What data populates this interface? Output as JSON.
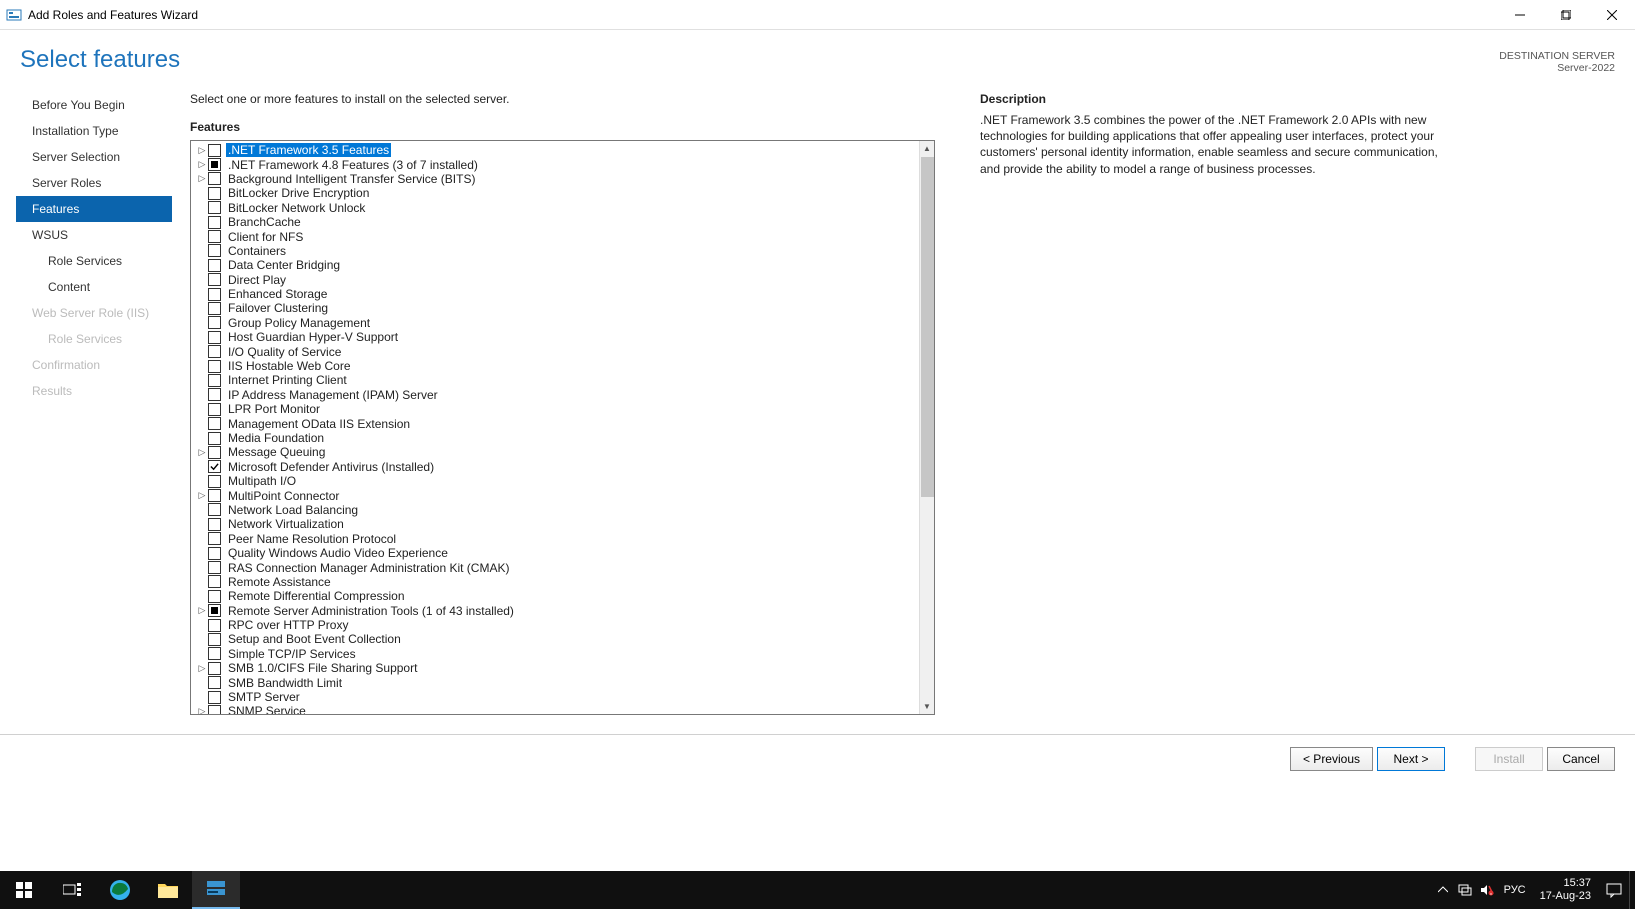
{
  "window": {
    "title": "Add Roles and Features Wizard"
  },
  "header": {
    "page_title": "Select features",
    "dest_label": "DESTINATION SERVER",
    "dest_value": "Server-2022"
  },
  "sidebar": {
    "items": [
      {
        "label": "Before You Begin",
        "state": "normal"
      },
      {
        "label": "Installation Type",
        "state": "normal"
      },
      {
        "label": "Server Selection",
        "state": "normal"
      },
      {
        "label": "Server Roles",
        "state": "normal"
      },
      {
        "label": "Features",
        "state": "active"
      },
      {
        "label": "WSUS",
        "state": "normal"
      },
      {
        "label": "Role Services",
        "state": "normal",
        "indent": 1
      },
      {
        "label": "Content",
        "state": "normal",
        "indent": 1
      },
      {
        "label": "Web Server Role (IIS)",
        "state": "disabled"
      },
      {
        "label": "Role Services",
        "state": "disabled",
        "indent": 1
      },
      {
        "label": "Confirmation",
        "state": "disabled"
      },
      {
        "label": "Results",
        "state": "disabled"
      }
    ]
  },
  "main": {
    "instruction": "Select one or more features to install on the selected server.",
    "features_heading": "Features",
    "description_heading": "Description",
    "description_text": ".NET Framework 3.5 combines the power of the .NET Framework 2.0 APIs with new technologies for building applications that offer appealing user interfaces, protect your customers' personal identity information, enable seamless and secure communication, and provide the ability to model a range of business processes.",
    "features": [
      {
        "label": ".NET Framework 3.5 Features",
        "expandable": true,
        "check": "unchecked",
        "selected": true
      },
      {
        "label": ".NET Framework 4.8 Features (3 of 7 installed)",
        "expandable": true,
        "check": "partial"
      },
      {
        "label": "Background Intelligent Transfer Service (BITS)",
        "expandable": true,
        "check": "unchecked"
      },
      {
        "label": "BitLocker Drive Encryption",
        "check": "unchecked"
      },
      {
        "label": "BitLocker Network Unlock",
        "check": "unchecked"
      },
      {
        "label": "BranchCache",
        "check": "unchecked"
      },
      {
        "label": "Client for NFS",
        "check": "unchecked"
      },
      {
        "label": "Containers",
        "check": "unchecked"
      },
      {
        "label": "Data Center Bridging",
        "check": "unchecked"
      },
      {
        "label": "Direct Play",
        "check": "unchecked"
      },
      {
        "label": "Enhanced Storage",
        "check": "unchecked"
      },
      {
        "label": "Failover Clustering",
        "check": "unchecked"
      },
      {
        "label": "Group Policy Management",
        "check": "unchecked"
      },
      {
        "label": "Host Guardian Hyper-V Support",
        "check": "unchecked"
      },
      {
        "label": "I/O Quality of Service",
        "check": "unchecked"
      },
      {
        "label": "IIS Hostable Web Core",
        "check": "unchecked"
      },
      {
        "label": "Internet Printing Client",
        "check": "unchecked"
      },
      {
        "label": "IP Address Management (IPAM) Server",
        "check": "unchecked"
      },
      {
        "label": "LPR Port Monitor",
        "check": "unchecked"
      },
      {
        "label": "Management OData IIS Extension",
        "check": "unchecked"
      },
      {
        "label": "Media Foundation",
        "check": "unchecked"
      },
      {
        "label": "Message Queuing",
        "expandable": true,
        "check": "unchecked"
      },
      {
        "label": "Microsoft Defender Antivirus (Installed)",
        "check": "checked"
      },
      {
        "label": "Multipath I/O",
        "check": "unchecked"
      },
      {
        "label": "MultiPoint Connector",
        "expandable": true,
        "check": "unchecked"
      },
      {
        "label": "Network Load Balancing",
        "check": "unchecked"
      },
      {
        "label": "Network Virtualization",
        "check": "unchecked"
      },
      {
        "label": "Peer Name Resolution Protocol",
        "check": "unchecked"
      },
      {
        "label": "Quality Windows Audio Video Experience",
        "check": "unchecked"
      },
      {
        "label": "RAS Connection Manager Administration Kit (CMAK)",
        "check": "unchecked"
      },
      {
        "label": "Remote Assistance",
        "check": "unchecked"
      },
      {
        "label": "Remote Differential Compression",
        "check": "unchecked"
      },
      {
        "label": "Remote Server Administration Tools (1 of 43 installed)",
        "expandable": true,
        "check": "partial"
      },
      {
        "label": "RPC over HTTP Proxy",
        "check": "unchecked"
      },
      {
        "label": "Setup and Boot Event Collection",
        "check": "unchecked"
      },
      {
        "label": "Simple TCP/IP Services",
        "check": "unchecked"
      },
      {
        "label": "SMB 1.0/CIFS File Sharing Support",
        "expandable": true,
        "check": "unchecked"
      },
      {
        "label": "SMB Bandwidth Limit",
        "check": "unchecked"
      },
      {
        "label": "SMTP Server",
        "check": "unchecked"
      },
      {
        "label": "SNMP Service",
        "expandable": true,
        "check": "unchecked"
      }
    ]
  },
  "buttons": {
    "previous": "< Previous",
    "next": "Next >",
    "install": "Install",
    "cancel": "Cancel"
  },
  "taskbar": {
    "lang": "РУС",
    "time": "15:37",
    "date": "17-Aug-23"
  }
}
